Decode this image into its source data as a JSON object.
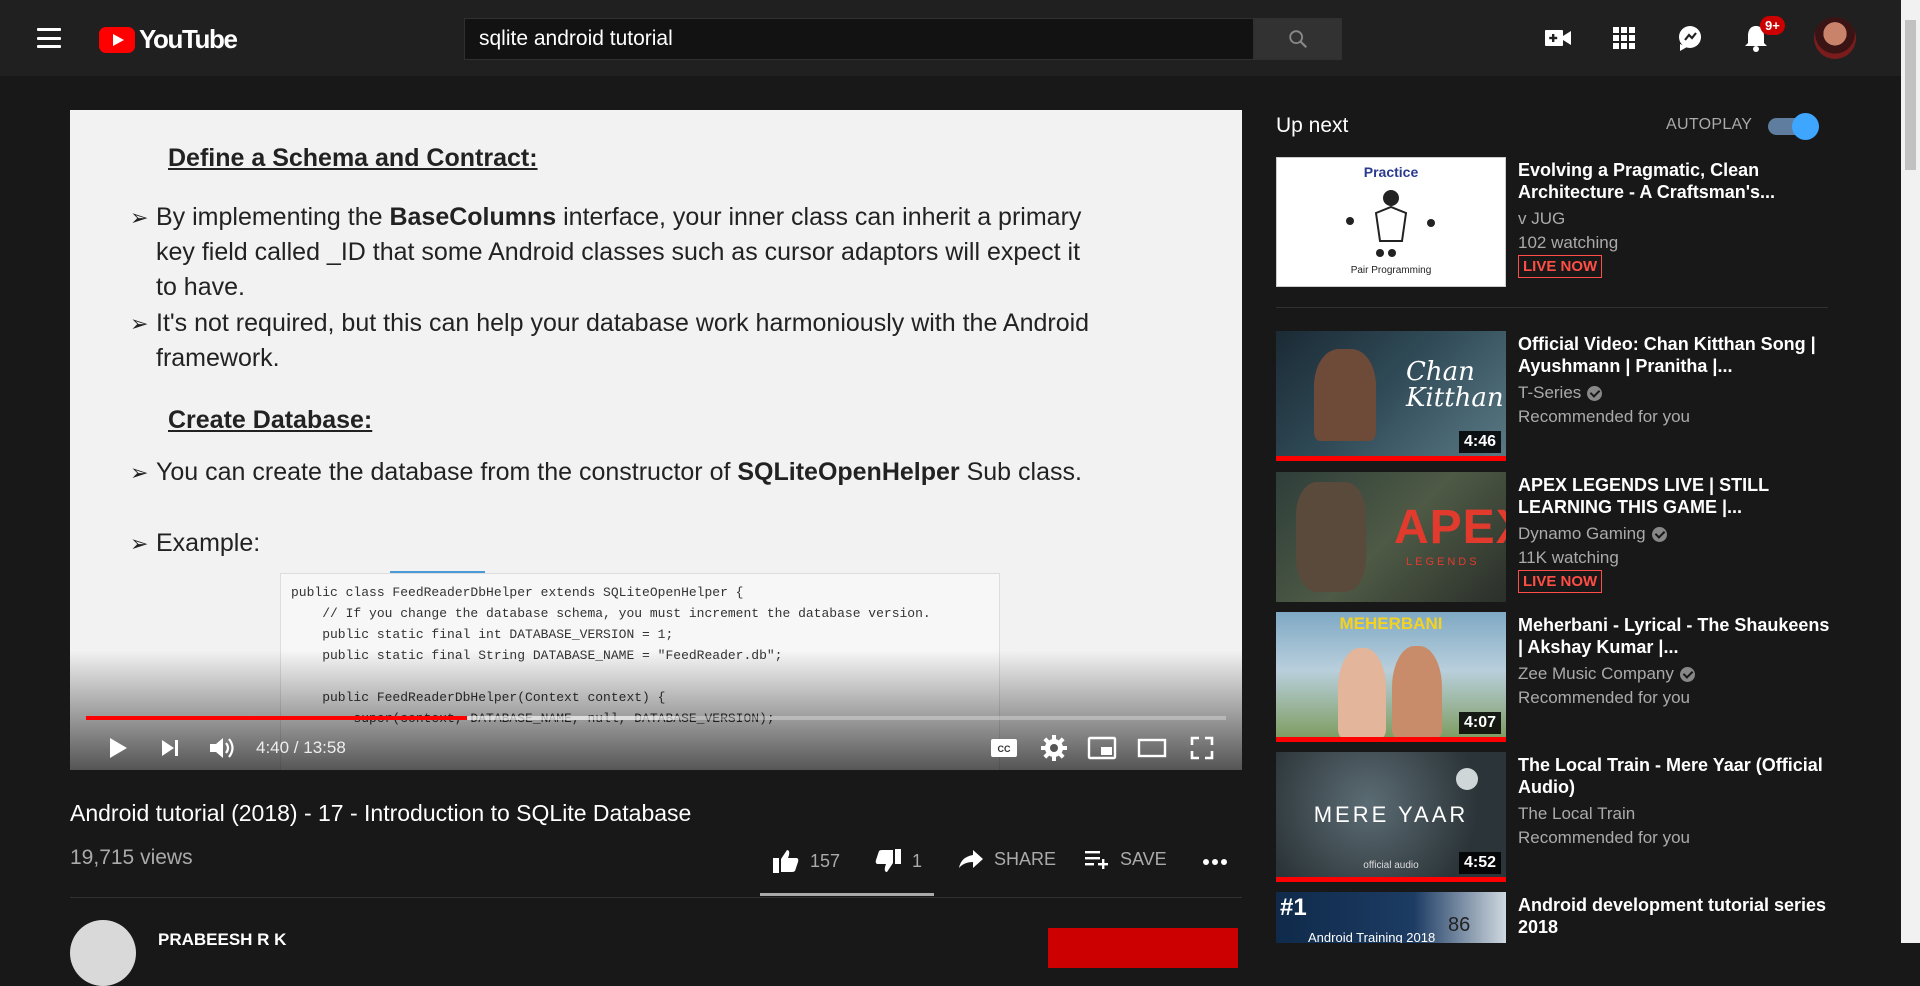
{
  "header": {
    "logo_text": "YouTube",
    "search_value": "sqlite android tutorial",
    "notification_count": "9+",
    "icons": [
      "menu-icon",
      "search-icon",
      "create-video-icon",
      "apps-icon",
      "messages-icon",
      "notifications-icon"
    ]
  },
  "player": {
    "slide": {
      "heading1": "Define a Schema and Contract:",
      "bullet1_pre": "By implementing the ",
      "bullet1_bold": "BaseColumns",
      "bullet1_post": " interface, your inner class can inherit a primary key field called _ID  that some Android classes such as cursor adaptors will expect it to have.",
      "bullet2": "It's not required, but this can help your database work harmoniously with the Android framework.",
      "heading2": "Create Database:",
      "bullet3_pre": "You can create the database from the constructor of ",
      "bullet3_bold": "SQLiteOpenHelper",
      "bullet3_post": " Sub class.",
      "bullet4": "Example:",
      "code": "public class FeedReaderDbHelper extends SQLiteOpenHelper {\n    // If you change the database schema, you must increment the database version.\n    public static final int DATABASE_VERSION = 1;\n    public static final String DATABASE_NAME = \"FeedReader.db\";\n\n    public FeedReaderDbHelper(Context context) {\n        super(context, DATABASE_NAME, null, DATABASE_VERSION);"
    },
    "time": "4:40 / 13:58",
    "progress_fraction": 0.334,
    "buffer_fraction": 0.52
  },
  "video": {
    "title": "Android tutorial (2018) - 17 - Introduction to SQLite Database",
    "views": "19,715 views",
    "likes": "157",
    "dislikes": "1",
    "share_label": "SHARE",
    "save_label": "SAVE",
    "channel_name": "PRABEESH R K"
  },
  "sidebar": {
    "up_next_label": "Up next",
    "autoplay_label": "AUTOPLAY",
    "autoplay_on": true,
    "items": [
      {
        "title": "Evolving a Pragmatic, Clean Architecture - A Craftsman's...",
        "channel": "v JUG",
        "meta": "102 watching",
        "live": "LIVE NOW",
        "thumb_text": "Practice",
        "thumb_sub": "Pair Programming"
      },
      {
        "title": "Official Video: Chan Kitthan Song | Ayushmann | Pranitha |...",
        "channel": "T-Series",
        "meta": "Recommended for you",
        "duration": "4:46",
        "thumb_text": "Chan Kitthan"
      },
      {
        "title": "APEX LEGENDS LIVE | STILL LEARNING THIS GAME |...",
        "channel": "Dynamo Gaming",
        "meta": "11K watching",
        "live": "LIVE NOW",
        "thumb_text": "APEX",
        "thumb_sub": "LEGENDS"
      },
      {
        "title": "Meherbani - Lyrical - The Shaukeens | Akshay Kumar |...",
        "channel": "Zee Music Company",
        "meta": "Recommended for you",
        "duration": "4:07",
        "thumb_text": "MEHERBANI"
      },
      {
        "title": "The Local Train - Mere Yaar (Official Audio)",
        "channel": "The Local Train",
        "meta": "Recommended for you",
        "duration": "4:52",
        "thumb_text": "MERE YAAR",
        "thumb_sub": "official audio"
      },
      {
        "title": "Android development tutorial series 2018",
        "thumb_text": "#1",
        "thumb_sub": "Android Training 2018",
        "thumb_num": "86"
      }
    ]
  },
  "colors": {
    "accent": "#ff0000",
    "live": "#ff4e45",
    "toggle": "#3ea6ff",
    "bg": "#181818",
    "header": "#202020"
  }
}
